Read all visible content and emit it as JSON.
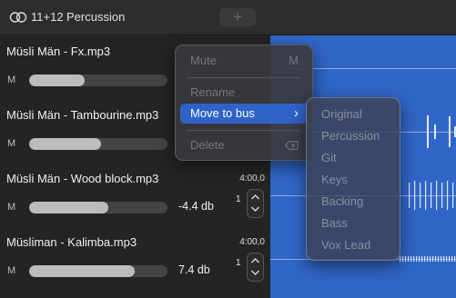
{
  "header": {
    "link_icon": "linked-circles-icon",
    "track_numbers": "11+12",
    "group_name": "Percussion",
    "add_label": "+"
  },
  "tracks": [
    {
      "title": "Müsli Män - Fx.mp3",
      "time": "",
      "mute": "M",
      "volume_fraction": 0.4,
      "db": "",
      "step_value": ""
    },
    {
      "title": "Müsli Män - Tambourine.mp3",
      "time": "",
      "mute": "M",
      "volume_fraction": 0.52,
      "db": "",
      "step_value": ""
    },
    {
      "title": "Müsli Män - Wood block.mp3",
      "time": "4:00,0",
      "mute": "M",
      "volume_fraction": 0.57,
      "db": "-4.4 db",
      "step_value": "1"
    },
    {
      "title": "Müsliman - Kalimba.mp3",
      "time": "4:00,0",
      "mute": "M",
      "volume_fraction": 0.76,
      "db": "7.4 db",
      "step_value": "1"
    }
  ],
  "context_menu": {
    "mute": {
      "label": "Mute",
      "shortcut": "M"
    },
    "rename": {
      "label": "Rename"
    },
    "move_to_bus": {
      "label": "Move to bus",
      "arrow": "›"
    },
    "delete": {
      "label": "Delete",
      "shortcut_icon": "delete-backward-icon"
    }
  },
  "bus_submenu": [
    "Original",
    "Percussion",
    "Git",
    "Keys",
    "Backing",
    "Bass",
    "Vox Lead"
  ],
  "colors": {
    "waveform_bg": "#3066c7",
    "menu_highlight": "#2f63c9"
  }
}
